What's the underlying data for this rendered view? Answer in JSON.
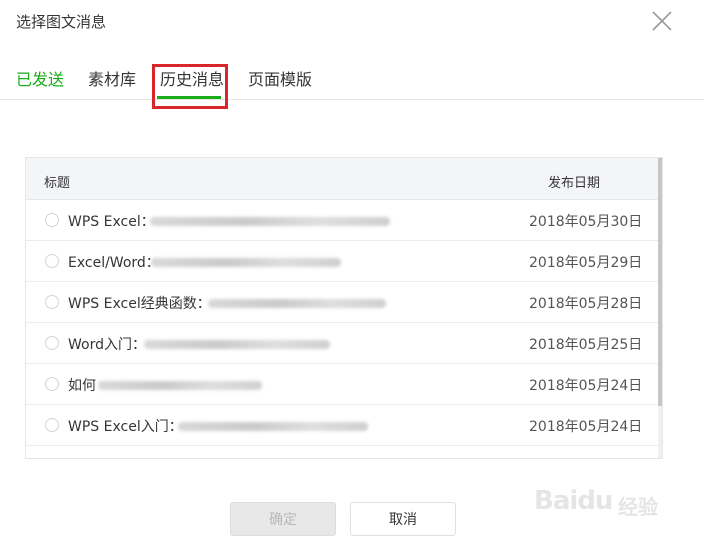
{
  "dialog": {
    "title": "选择图文消息"
  },
  "tabs": [
    {
      "label": "已发送"
    },
    {
      "label": "素材库"
    },
    {
      "label": "历史消息"
    },
    {
      "label": "页面模版"
    }
  ],
  "table": {
    "header_title": "标题",
    "header_date": "发布日期",
    "rows": [
      {
        "prefix": "WPS Excel：",
        "date": "2018年05月30日"
      },
      {
        "prefix": "Excel/Word：",
        "date": "2018年05月29日"
      },
      {
        "prefix": "WPS Excel经典函数：",
        "date": "2018年05月28日"
      },
      {
        "prefix": "Word入门：",
        "date": "2018年05月25日"
      },
      {
        "prefix": "如何",
        "date": "2018年05月24日"
      },
      {
        "prefix": "WPS Excel入门：",
        "date": "2018年05月24日"
      }
    ]
  },
  "buttons": {
    "confirm": "确定",
    "cancel": "取消"
  },
  "watermark": {
    "brand": "Baidu",
    "sub": "经验"
  },
  "colors": {
    "accent_green": "#1aad19",
    "highlight_red": "#d9262a",
    "header_bg": "#f4f5f9"
  }
}
